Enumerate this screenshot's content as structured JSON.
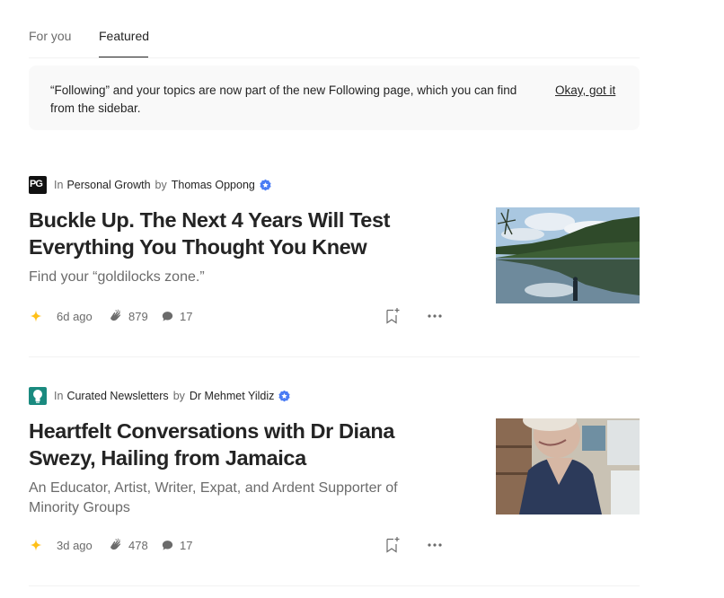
{
  "tabs": [
    {
      "label": "For you"
    },
    {
      "label": "Featured"
    }
  ],
  "notice": {
    "text": "“Following” and your topics are now part of the new Following page, which you can find from the sidebar.",
    "action": "Okay, got it"
  },
  "articles": [
    {
      "in_label": "In",
      "publication": "Personal Growth",
      "by_label": "by",
      "author": "Thomas Oppong",
      "title": "Buckle Up. The Next 4 Years Will Test Everything You Thought You Knew",
      "subtitle": "Find your “goldilocks zone.”",
      "date": "6d ago",
      "claps": "879",
      "responses": "17",
      "publication_logo_text": "PG",
      "thumbnail": "lake-forest-reflection"
    },
    {
      "in_label": "In",
      "publication": "Curated Newsletters",
      "by_label": "by",
      "author": "Dr Mehmet Yildiz",
      "title": "Heartfelt Conversations with Dr Diana Swezy, Hailing from Jamaica",
      "subtitle": "An Educator, Artist, Writer, Expat, and Ardent Supporter of Minority Groups",
      "date": "3d ago",
      "claps": "478",
      "responses": "17",
      "thumbnail": "smiling-woman-portrait"
    }
  ],
  "colors": {
    "text": "#242424",
    "muted": "#6b6b6b",
    "banner_bg": "#f9f9f9",
    "verified": "#4a7cf4",
    "star": "#ffc017"
  }
}
